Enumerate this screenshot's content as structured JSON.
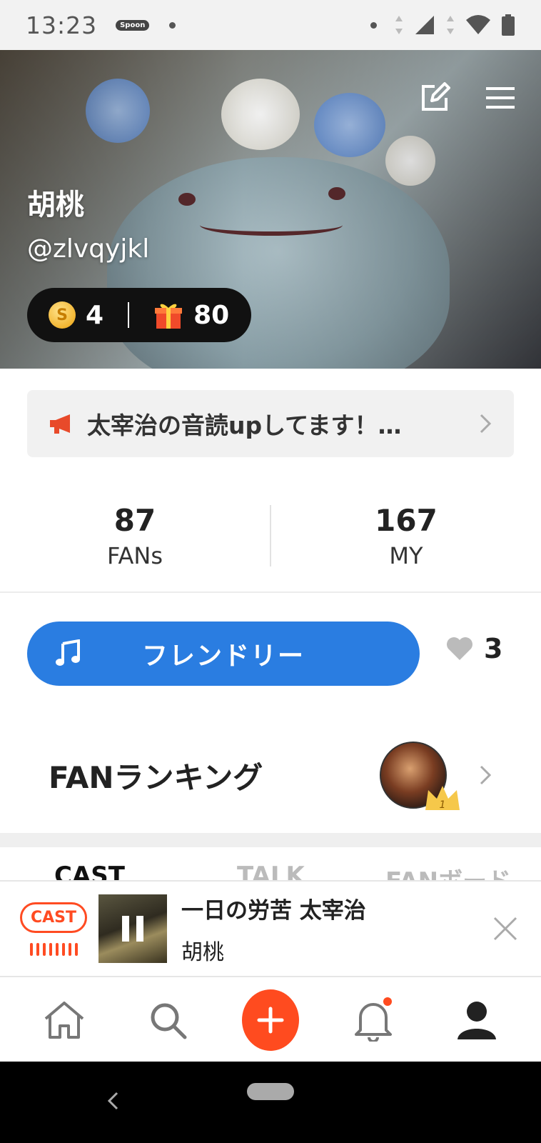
{
  "status_bar": {
    "time": "13:23",
    "app_badge": "Spoon"
  },
  "profile": {
    "name": "胡桃",
    "handle": "@zlvqyjkl",
    "coins": "4",
    "gifts": "80",
    "coin_symbol": "S"
  },
  "notice": {
    "text": "太宰治の音読upしてます！…"
  },
  "stats": [
    {
      "value": "87",
      "label": "FANs"
    },
    {
      "value": "167",
      "label": "MY"
    }
  ],
  "friendly": {
    "label": "フレンドリー",
    "likes": "3"
  },
  "ranking": {
    "title": "FANランキング",
    "rank_number": "1"
  },
  "tabs": [
    "CAST",
    "TALK",
    "FANボード"
  ],
  "player": {
    "badge": "CAST",
    "title": "一日の労苦 太宰治",
    "artist": "胡桃"
  },
  "colors": {
    "accent_blue": "#2a7de1",
    "accent_orange": "#ff4b1f"
  },
  "icons": {
    "edit": "edit-icon",
    "menu": "menu-icon",
    "megaphone": "megaphone-icon",
    "music": "music-note-icon",
    "heart": "heart-icon",
    "home": "home-icon",
    "search": "search-icon",
    "add": "plus-icon",
    "bell": "bell-icon",
    "profile": "profile-icon"
  }
}
